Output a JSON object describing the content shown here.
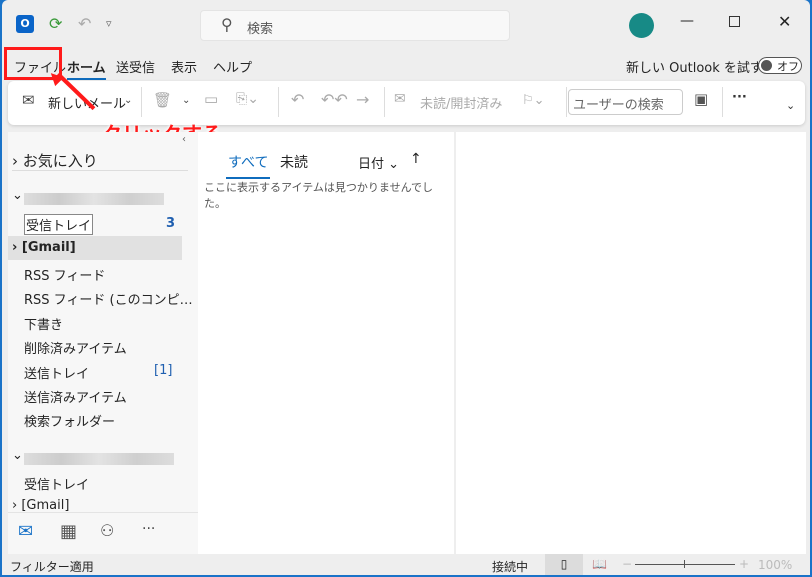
{
  "titlebar": {
    "search_placeholder": "検索",
    "icons": [
      "outlook-logo",
      "sync-icon",
      "undo-icon",
      "customize-quick-access-icon"
    ]
  },
  "menu": {
    "items": [
      "ファイル",
      "ホーム",
      "送受信",
      "表示",
      "ヘルプ"
    ],
    "active": "ホーム",
    "new_outlook_label": "新しい Outlook を試す",
    "toggle_label": "オフ",
    "toggle_on": false
  },
  "ribbon": {
    "new_mail": "新しいメール",
    "unread_read": "未読/開封済み",
    "user_search_placeholder": "ユーザーの検索",
    "more": "···"
  },
  "annotation": {
    "text": "クリックする",
    "color": "#ff1a1a"
  },
  "folders": {
    "favorites": "お気に入り",
    "account1": [
      {
        "label": "受信トレイ",
        "count": "3"
      },
      {
        "label": "[Gmail]"
      },
      {
        "label": "RSS フィード"
      },
      {
        "label": "RSS フィード (このコンピ…"
      },
      {
        "label": "下書き"
      },
      {
        "label": "削除済みアイテム"
      },
      {
        "label": "送信トレイ",
        "count": "[1]"
      },
      {
        "label": "送信済みアイテム"
      },
      {
        "label": "検索フォルダー"
      }
    ],
    "account2": [
      {
        "label": "受信トレイ"
      },
      {
        "label": "[Gmail]"
      }
    ]
  },
  "list": {
    "tab_all": "すべて",
    "tab_unread": "未読",
    "sort": "日付",
    "empty": "ここに表示するアイテムは見つかりませんでした。"
  },
  "status": {
    "filter": "フィルター適用",
    "connection": "接続中",
    "zoom": "100%"
  },
  "colors": {
    "accent": "#0f6cbd",
    "count": "#1f5fb0"
  }
}
